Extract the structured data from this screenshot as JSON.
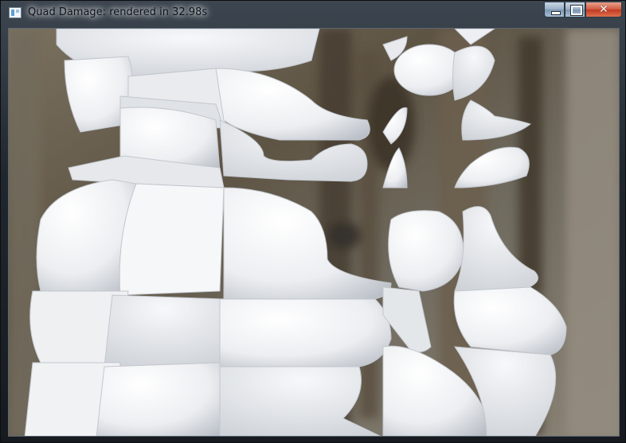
{
  "window": {
    "title": "Quad Damage: rendered in 32.98s",
    "controls": {
      "minimize_glyph": "minimize-icon",
      "maximize_glyph": "maximize-icon",
      "close_glyph": "✕"
    }
  },
  "colors": {
    "frame": "#1c2228",
    "close_button": "#c8452b",
    "surface": "#f2f3f5",
    "background_dark": "#4e4436",
    "background_light": "#8c8578"
  }
}
